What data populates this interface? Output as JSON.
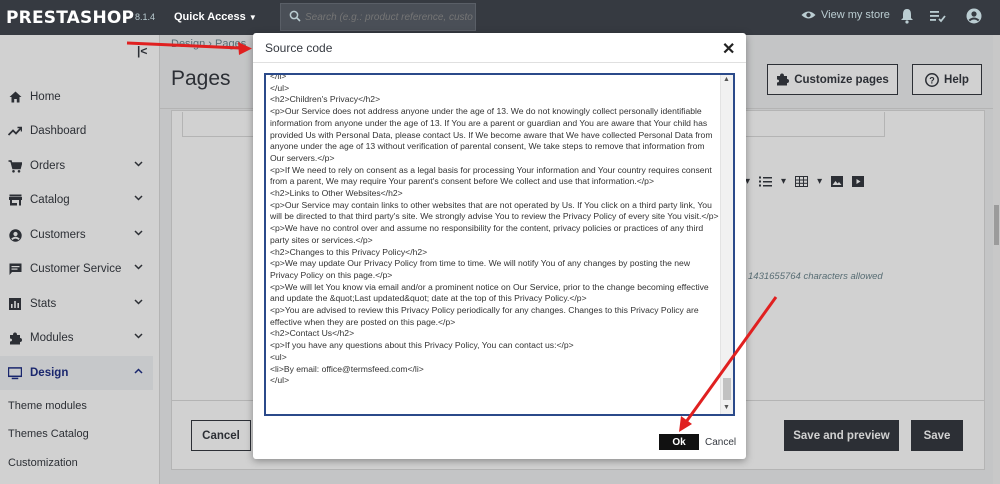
{
  "topbar": {
    "logo": "PRESTASHOP",
    "version": "8.1.4",
    "quick_access": "Quick Access",
    "search_placeholder": "Search (e.g.: product reference, custon",
    "view_store": "View my store"
  },
  "sidebar": {
    "items": [
      {
        "label": "Home",
        "icon": "home-icon"
      },
      {
        "label": "Dashboard",
        "icon": "trending-up-icon"
      },
      {
        "label": "Orders",
        "icon": "cart-icon"
      },
      {
        "label": "Catalog",
        "icon": "store-icon"
      },
      {
        "label": "Customers",
        "icon": "account-circle-icon"
      },
      {
        "label": "Customer Service",
        "icon": "chat-icon"
      },
      {
        "label": "Stats",
        "icon": "bar-chart-icon"
      },
      {
        "label": "Modules",
        "icon": "puzzle-icon"
      },
      {
        "label": "Design",
        "icon": "desktop-icon"
      }
    ],
    "sub_items": [
      "Theme modules",
      "Themes Catalog",
      "Customization"
    ]
  },
  "page": {
    "breadcrumb": "Design › Pages",
    "title": "Pages",
    "customize_button": "Customize pages",
    "help_button": "Help",
    "chars_allowed": "1431655764 characters allowed"
  },
  "footer": {
    "cancel": "Cancel",
    "save_preview": "Save and preview",
    "save": "Save"
  },
  "modal": {
    "title": "Source code",
    "ok": "Ok",
    "cancel": "Cancel",
    "code_lines": [
      "</li>",
      "</ul>",
      "<h2>Children's Privacy</h2>",
      "<p>Our Service does not address anyone under the age of 13. We do not knowingly collect personally identifiable information from anyone under the age of 13. If You are a parent or guardian and You are aware that Your child has provided Us with Personal Data, please contact Us. If We become aware that We have collected Personal Data from anyone under the age of 13 without verification of parental consent, We take steps to remove that information from Our servers.</p>",
      "<p>If We need to rely on consent as a legal basis for processing Your information and Your country requires consent from a parent, We may require Your parent's consent before We collect and use that information.</p>",
      "<h2>Links to Other Websites</h2>",
      "<p>Our Service may contain links to other websites that are not operated by Us. If You click on a third party link, You will be directed to that third party's site. We strongly advise You to review the Privacy Policy of every site You visit.</p>",
      "<p>We have no control over and assume no responsibility for the content, privacy policies or practices of any third party sites or services.</p>",
      "<h2>Changes to this Privacy Policy</h2>",
      "<p>We may update Our Privacy Policy from time to time. We will notify You of any changes by posting the new Privacy Policy on this page.</p>",
      "<p>We will let You know via email and/or a prominent notice on Our Service, prior to the change becoming effective and update the &quot;Last updated&quot; date at the top of this Privacy Policy.</p>",
      "<p>You are advised to review this Privacy Policy periodically for any changes. Changes to this Privacy Policy are effective when they are posted on this page.</p>",
      "<h2>Contact Us</h2>",
      "<p>If you have any questions about this Privacy Policy, You can contact us:</p>",
      "<ul>",
      "<li>By email: office@termsfeed.com</li>",
      "</ul>"
    ]
  },
  "colors": {
    "topbar": "#363a41",
    "accent": "#25b9d7",
    "annotation_arrow": "#e02020",
    "code_border": "#2b4a8a"
  }
}
